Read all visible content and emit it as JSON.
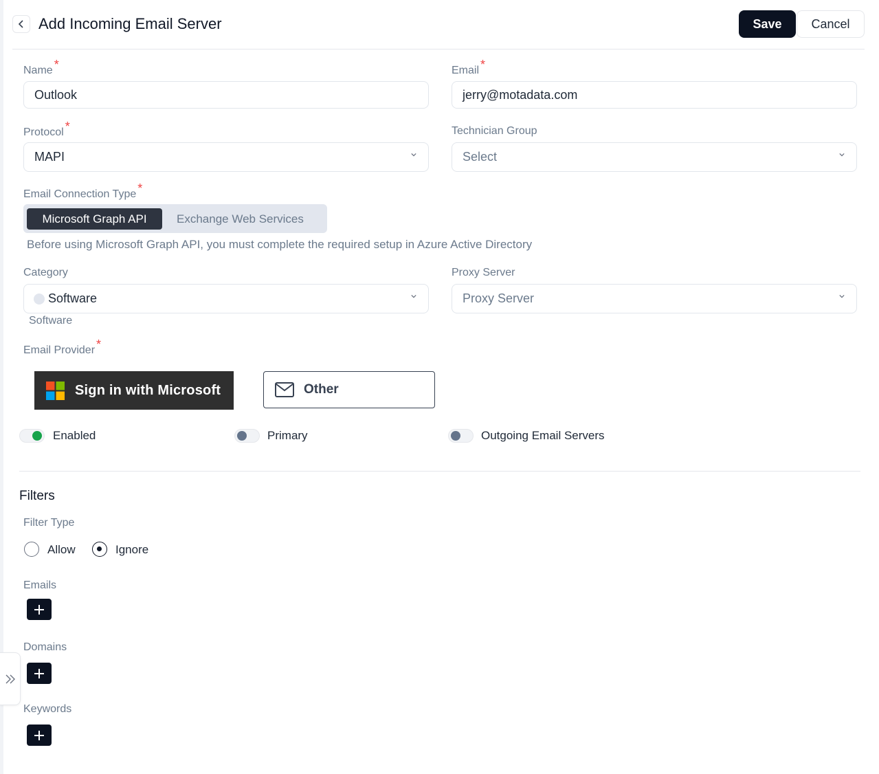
{
  "header": {
    "title": "Add Incoming Email Server",
    "save_label": "Save",
    "cancel_label": "Cancel"
  },
  "form": {
    "name": {
      "label": "Name",
      "value": "Outlook",
      "required_mark": "*"
    },
    "email": {
      "label": "Email",
      "value": "jerry@motadata.com",
      "required_mark": "*"
    },
    "protocol": {
      "label": "Protocol",
      "value": "MAPI",
      "required_mark": "*"
    },
    "technician_group": {
      "label": "Technician Group",
      "placeholder": "Select"
    },
    "connection_type": {
      "label": "Email Connection Type",
      "required_mark": "*",
      "options": [
        "Microsoft Graph API",
        "Exchange Web Services"
      ],
      "selected": "Microsoft Graph API",
      "hint": "Before using Microsoft Graph API, you must complete the required setup in Azure Active Directory"
    },
    "category": {
      "label": "Category",
      "value": "Software",
      "sub_value": "Software"
    },
    "proxy_server": {
      "label": "Proxy Server",
      "placeholder": "Proxy Server"
    },
    "email_provider": {
      "label": "Email Provider",
      "required_mark": "*",
      "microsoft_label": "Sign in with Microsoft",
      "other_label": "Other"
    }
  },
  "toggles": [
    {
      "label": "Enabled",
      "on": true
    },
    {
      "label": "Primary",
      "on": false
    },
    {
      "label": "Outgoing Email Servers",
      "on": false
    }
  ],
  "filters": {
    "title": "Filters",
    "filter_type_label": "Filter Type",
    "options": [
      "Allow",
      "Ignore"
    ],
    "selected": "Ignore",
    "emails_label": "Emails",
    "domains_label": "Domains",
    "keywords_label": "Keywords"
  },
  "colors": {
    "primary": "#0b1221",
    "toggle_on": "#16a34a",
    "toggle_off": "#64748b",
    "required": "#ef4444"
  },
  "icons": {
    "back": "chevron-left-icon",
    "dropdown": "chevron-down-icon",
    "add": "plus-icon",
    "collapse": "double-chevron-right-icon",
    "other_provider": "mail-icon",
    "microsoft": "microsoft-logo-icon"
  }
}
